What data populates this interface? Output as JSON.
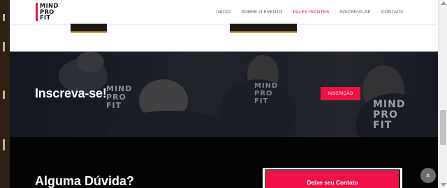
{
  "header": {
    "logo": {
      "lines": [
        "MIND",
        "PRO",
        "FIT"
      ],
      "accent_color": "#e8103a"
    },
    "nav": [
      {
        "label": "INÍCIO",
        "active": false
      },
      {
        "label": "SOBRE O EVENTO",
        "active": false
      },
      {
        "label": "PALESTRANTES",
        "active": true
      },
      {
        "label": "INSCREVA-SE",
        "active": false
      },
      {
        "label": "CONTATO",
        "active": false
      }
    ]
  },
  "banner": {
    "title": "Inscreva-se!",
    "button_label": "INSCRIÇÃO",
    "shirt_lines": [
      "MIND",
      "PRO",
      "FIT"
    ]
  },
  "contact": {
    "title": "Alguma Dúvida?",
    "button_label": "Deixe seu Contato"
  },
  "scroll_top": {
    "icon": "double-chevron-up-icon",
    "glyph": "»"
  },
  "colors": {
    "brand": "#ee1241",
    "banner_bg": "#181c24",
    "contact_bg": "#040404"
  }
}
